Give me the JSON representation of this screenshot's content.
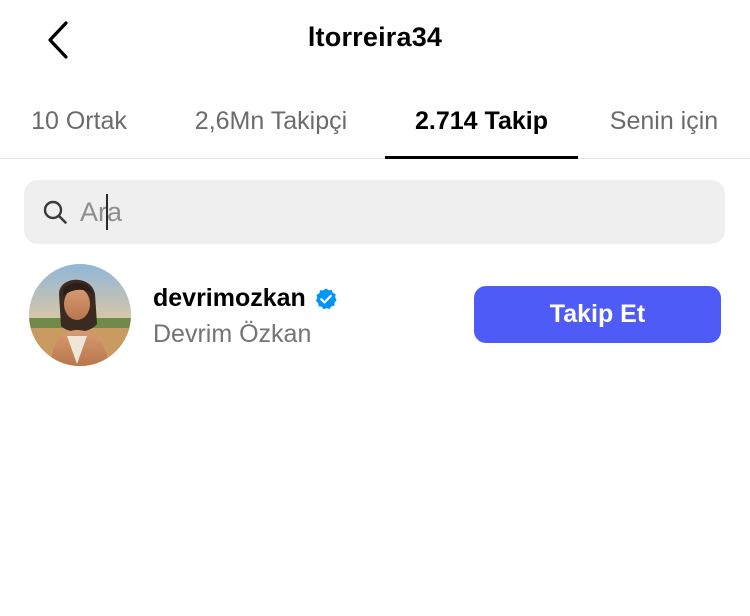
{
  "header": {
    "title": "ltorreira34",
    "back_icon": "chevron-left-icon"
  },
  "tabs": [
    {
      "label": "10 Ortak",
      "active": false
    },
    {
      "label": "2,6Mn Takipçi",
      "active": false
    },
    {
      "label": "2.714 Takip",
      "active": true
    },
    {
      "label": "Senin için",
      "active": false
    }
  ],
  "search": {
    "placeholder": "Ara",
    "value": "",
    "icon": "search-icon"
  },
  "users": [
    {
      "username": "devrimozkan",
      "full_name": "Devrim Özkan",
      "verified": true,
      "follow_label": "Takip Et"
    }
  ],
  "colors": {
    "follow_button": "#4f5bf7",
    "verified_badge": "#0095f6",
    "search_background": "#efefef",
    "secondary_text": "#737373"
  }
}
